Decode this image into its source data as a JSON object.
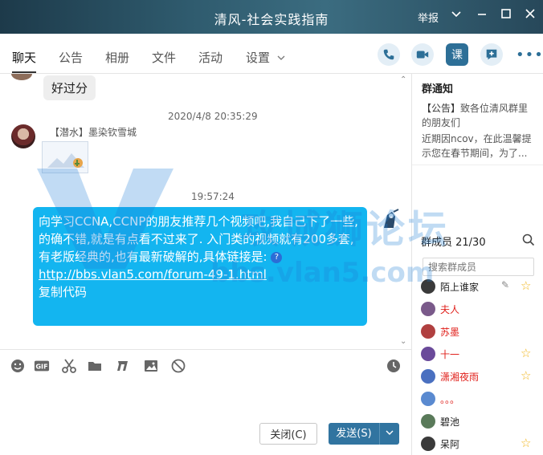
{
  "window": {
    "title": "清风-社会实践指南",
    "titlebar_label": "举报"
  },
  "tabs": [
    {
      "label": "聊天"
    },
    {
      "label": "公告"
    },
    {
      "label": "相册"
    },
    {
      "label": "文件"
    },
    {
      "label": "活动"
    },
    {
      "label": "设置"
    }
  ],
  "header_buttons": {
    "course_label": "课"
  },
  "chat": {
    "messages": {
      "m1_text": "好过分",
      "m2_time": "2020/4/8 20:35:29",
      "m2_sender": "【潜水】墨染钦雪城",
      "m3_time": "19:57:24",
      "m3_text": "向学习CCNA,CCNP的朋友推荐几个视频吧,我自己下了一些,的确不错,就是有点看不过来了. 入门类的视频就有200多套,有老版经典的,也有最新破解的,具体链接是:",
      "m3_link": "http://bbs.vlan5.com/forum-49-1.html",
      "m3_copy": "复制代码"
    }
  },
  "input": {
    "close_label": "关闭(C)",
    "send_label": "发送(S)"
  },
  "notice": {
    "title": "群通知",
    "tag": "【公告】",
    "line1": "致各位清风群里的朋友们",
    "line2": "近期因ncov，在此温馨提示您在春节期间，为了..."
  },
  "members": {
    "header": "群成员 21/30",
    "search_placeholder": "搜索群成员",
    "list": [
      {
        "name": "陌上谁家",
        "color": "#222222",
        "star": true
      },
      {
        "name": "夫人",
        "color": "#e0201b",
        "star": false
      },
      {
        "name": "苏墨",
        "color": "#e0201b",
        "star": false
      },
      {
        "name": "十一",
        "color": "#e0201b",
        "star": true
      },
      {
        "name": "潇湘夜雨",
        "color": "#e0201b",
        "star": true
      },
      {
        "name": "。。。",
        "color": "#e0201b",
        "star": false
      },
      {
        "name": "碧池",
        "color": "#222222",
        "star": false
      },
      {
        "name": "呆阿",
        "color": "#222222",
        "star": true
      }
    ]
  },
  "watermark": {
    "text1": "攻城狮论坛",
    "text2": "bbs.vlan5.com"
  },
  "colors": {
    "accent": "#13b5f0",
    "send_button": "#3174a0",
    "admin_red": "#e0201b",
    "star": "#f1b51c"
  }
}
